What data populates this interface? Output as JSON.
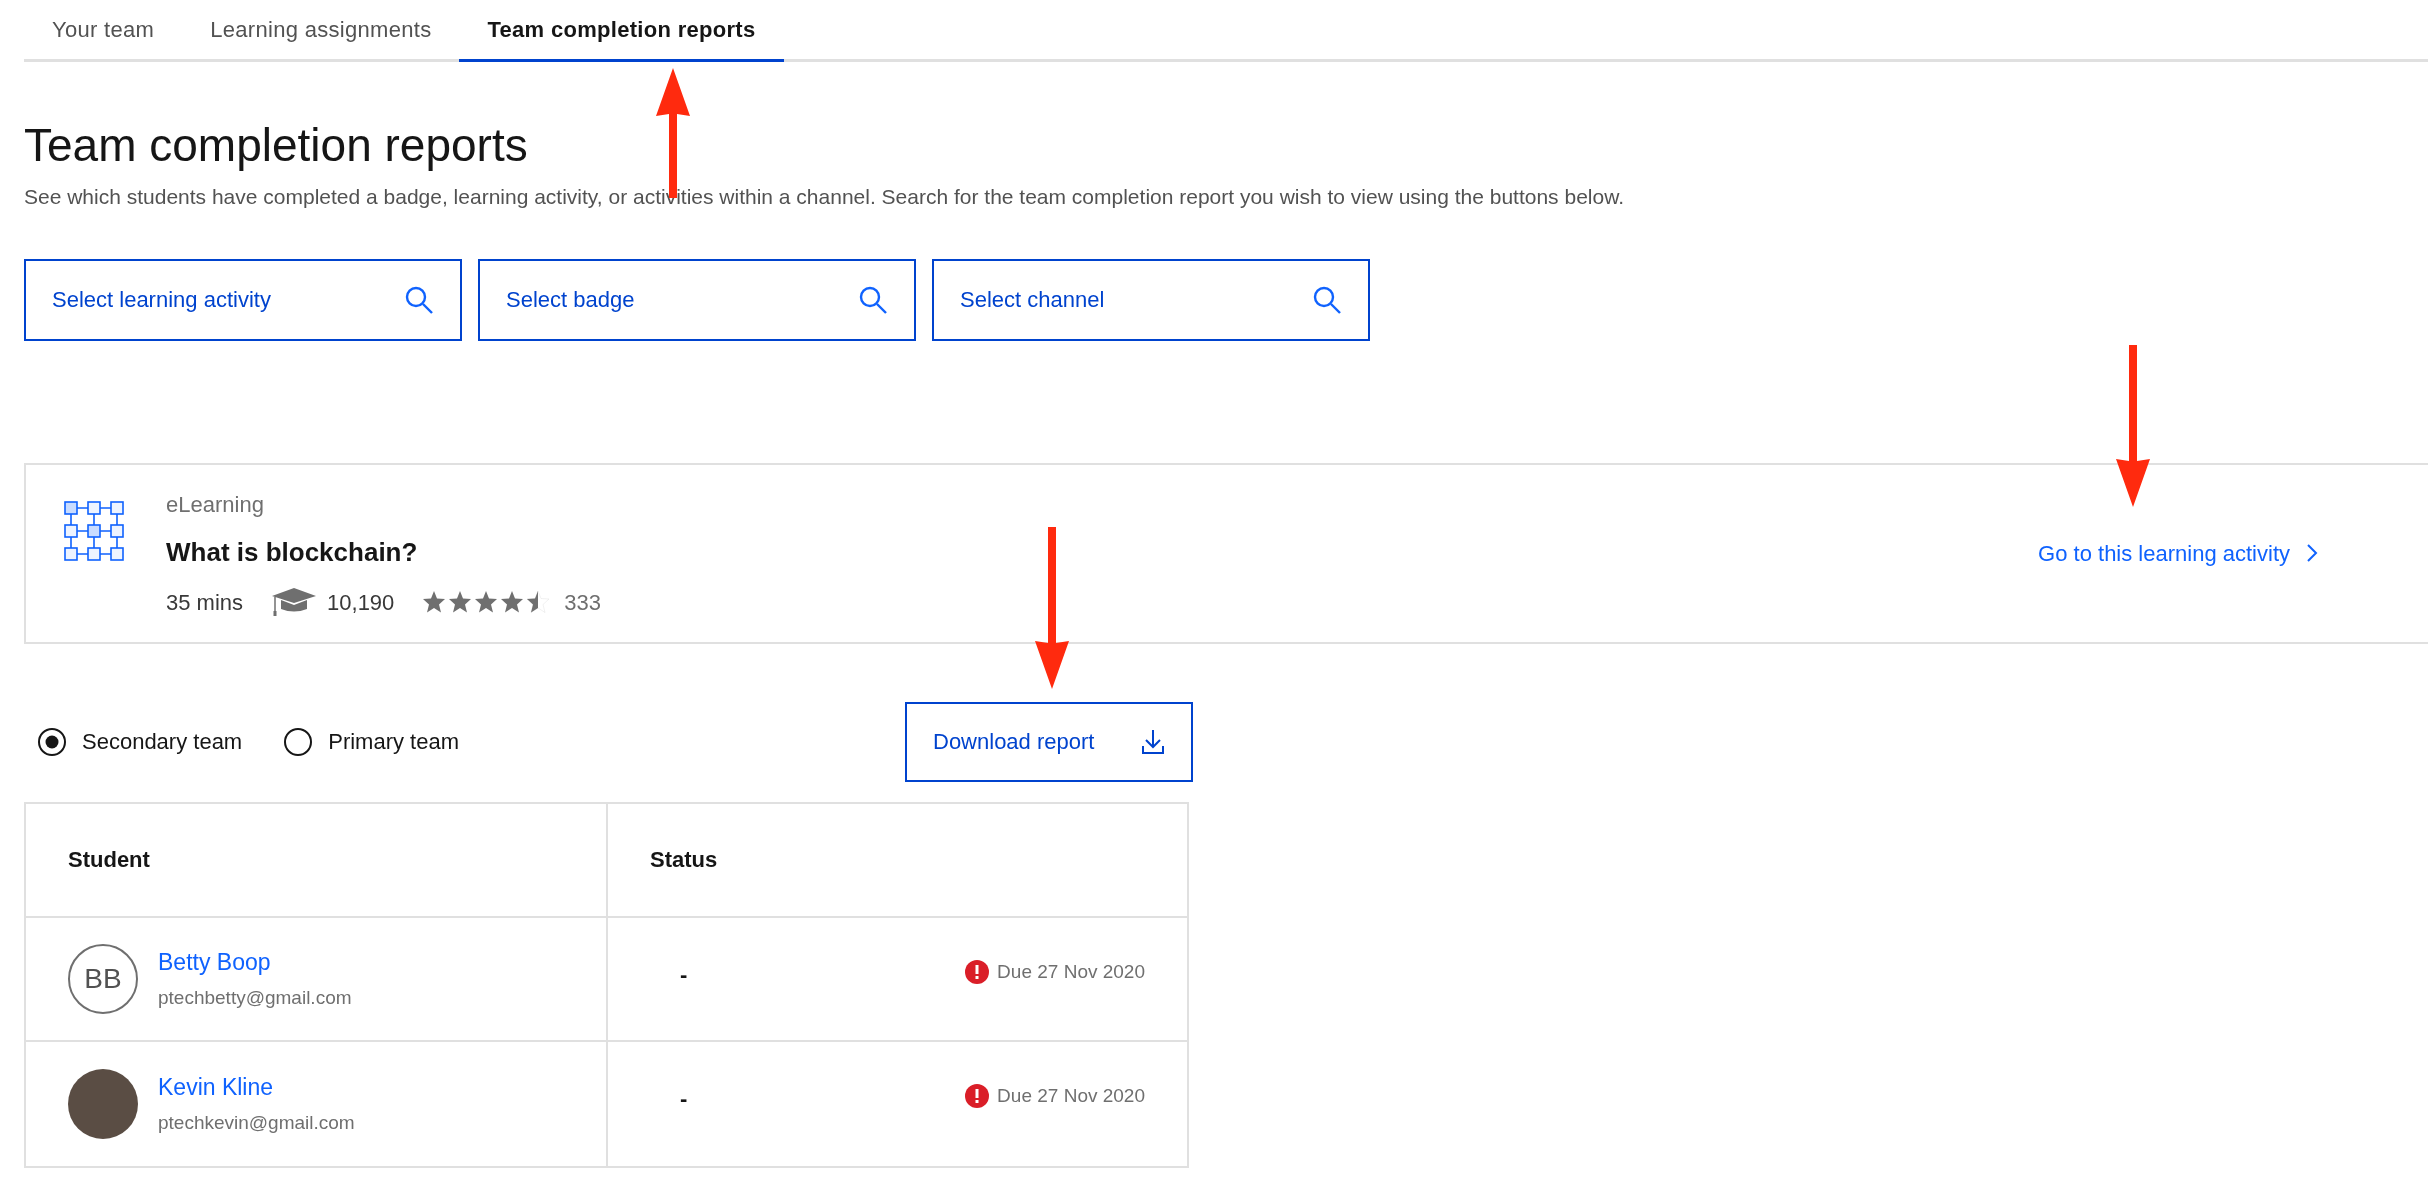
{
  "tabs": [
    {
      "label": "Your team",
      "selected": false
    },
    {
      "label": "Learning assignments",
      "selected": false
    },
    {
      "label": "Team completion reports",
      "selected": true
    }
  ],
  "header": {
    "title": "Team completion reports",
    "description": "See which students have completed a badge, learning activity, or activities within a channel. Search for the team completion report you wish to view using the buttons below."
  },
  "search_buttons": [
    "Select learning activity",
    "Select badge",
    "Select channel"
  ],
  "activity": {
    "type": "eLearning",
    "title": "What is blockchain?",
    "duration": "35 mins",
    "learners": "10,190",
    "stars": 4.5,
    "rating_count": "333",
    "link": "Go to this learning activity"
  },
  "team_options": [
    {
      "label": "Secondary team",
      "selected": true
    },
    {
      "label": "Primary team",
      "selected": false
    }
  ],
  "download_button": "Download report",
  "table": {
    "columns": [
      "Student",
      "Status"
    ],
    "rows": [
      {
        "avatar": {
          "kind": "initials",
          "initials": "BB"
        },
        "name": "Betty Boop",
        "email": "ptechbetty@gmail.com",
        "status": "-",
        "due": "Due 27 Nov 2020",
        "overdue": true
      },
      {
        "avatar": {
          "kind": "photo"
        },
        "name": "Kevin Kline",
        "email": "ptechkevin@gmail.com",
        "status": "-",
        "due": "Due 27 Nov 2020",
        "overdue": true
      }
    ]
  }
}
